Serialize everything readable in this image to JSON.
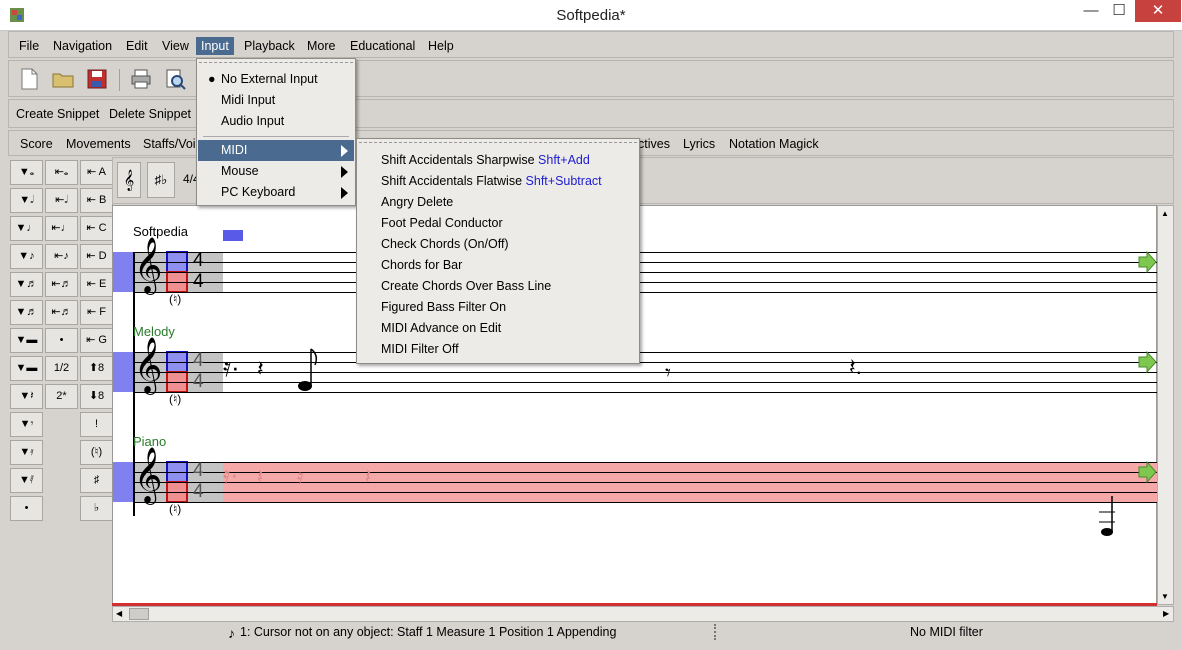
{
  "window": {
    "title": "Softpedia*"
  },
  "menubar": [
    "File",
    "Navigation",
    "Edit",
    "View",
    "Input",
    "Playback",
    "More",
    "Educational",
    "Help"
  ],
  "snippets": {
    "create": "Create Snippet",
    "delete": "Delete Snippet"
  },
  "object_menu": [
    "Score",
    "Movements",
    "Staffs/Voi",
    "ctives",
    "Lyrics",
    "Notation Magick"
  ],
  "palette": [
    [
      "▼𝅝",
      "⇤𝅝",
      "⇤ A"
    ],
    [
      "▼𝅗𝅥",
      "⇤𝅗𝅥",
      "⇤ B"
    ],
    [
      "▼♩",
      "⇤♩",
      "⇤ C"
    ],
    [
      "▼♪",
      "⇤♪",
      "⇤ D"
    ],
    [
      "▼♬",
      "⇤♬",
      "⇤ E"
    ],
    [
      "▼♬",
      "⇤♬",
      "⇤ F"
    ],
    [
      "▼▬",
      "•",
      "⇤ G"
    ],
    [
      "▼▬",
      "1/2",
      "⬆8"
    ],
    [
      "▼𝄽",
      "2*",
      "⬇8"
    ],
    [
      "▼𝄾",
      "",
      "!"
    ],
    [
      "▼𝄿",
      "",
      "(♮)"
    ],
    [
      "▼𝅀",
      "",
      "♯"
    ],
    [
      "•",
      "",
      "♭"
    ]
  ],
  "toolstrip": {
    "time_sig": "4/4"
  },
  "input_menu": {
    "items": [
      "No External Input",
      "Midi Input",
      "Audio Input"
    ],
    "selected_radio": "No External Input",
    "submenus": [
      "MIDI",
      "Mouse",
      "PC Keyboard"
    ]
  },
  "midi_submenu": [
    {
      "label": "Shift Accidentals Sharpwise",
      "shortcut": "Shft+Add"
    },
    {
      "label": "Shift Accidentals Flatwise",
      "shortcut": "Shft+Subtract"
    },
    {
      "label": "Angry Delete",
      "shortcut": ""
    },
    {
      "label": "Foot Pedal Conductor",
      "shortcut": ""
    },
    {
      "label": "Check Chords (On/Off)",
      "shortcut": ""
    },
    {
      "label": "Chords for Bar",
      "shortcut": ""
    },
    {
      "label": "Create Chords Over Bass Line",
      "shortcut": ""
    },
    {
      "label": "Figured Bass Filter On",
      "shortcut": ""
    },
    {
      "label": "MIDI Advance on Edit",
      "shortcut": ""
    },
    {
      "label": "MIDI Filter Off",
      "shortcut": ""
    }
  ],
  "score": {
    "staffs": [
      {
        "name": "Softpedia",
        "time_top": "4",
        "time_bottom": "4",
        "natural": "(♮)"
      },
      {
        "name": "Melody",
        "time_top": "4",
        "time_bottom": "4",
        "natural": "(♮)"
      },
      {
        "name": "Piano",
        "time_top": "4",
        "time_bottom": "4",
        "natural": "(♮)"
      }
    ]
  },
  "status": {
    "cursor": "1: Cursor not on any object:  Staff 1 Measure 1 Position 1 Appending",
    "midi": "No MIDI filter"
  },
  "colors": {
    "menu_highlight": "#4a6b8f",
    "shortcut": "#2020d0",
    "piano_staff": "#f5a8a8",
    "label_bg": "#b6e3b6"
  }
}
